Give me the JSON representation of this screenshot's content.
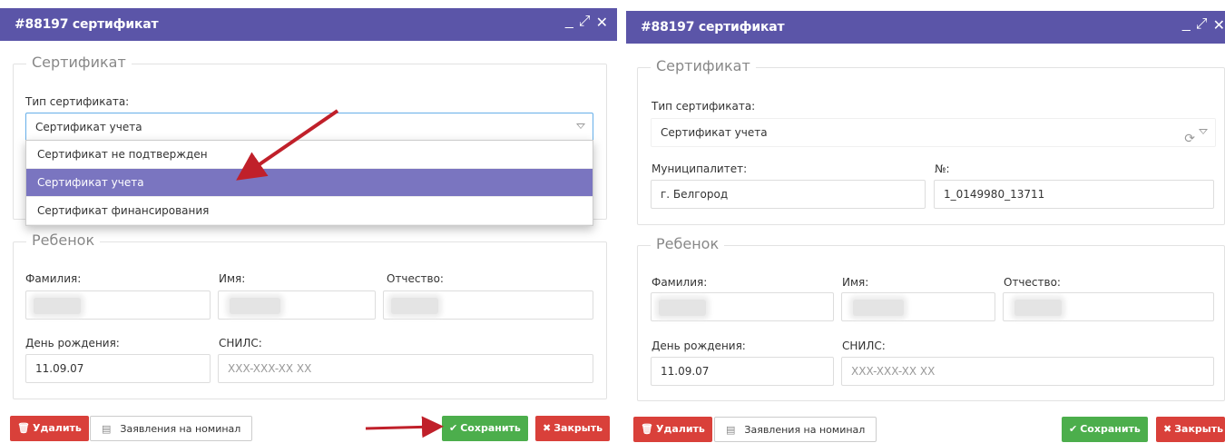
{
  "left": {
    "title": "#88197 сертификат",
    "section_certificate": "Сертификат",
    "cert_type_label": "Тип сертификата:",
    "cert_type_value": "Сертификат учета",
    "dropdown_options": [
      "Сертификат не подтвержден",
      "Сертификат учета",
      "Сертификат финансирования"
    ],
    "section_child": "Ребенок",
    "surname_label": "Фамилия:",
    "name_label": "Имя:",
    "patronymic_label": "Отчество:",
    "birthday_label": "День рождения:",
    "birthday_value": "11.09.07",
    "snils_label": "СНИЛС:",
    "snils_placeholder": "XXX-XXX-XX XX",
    "delete_label": "Удалить",
    "applications_label": "Заявления на номинал",
    "save_label": "Сохранить",
    "close_label": "Закрыть"
  },
  "right": {
    "title": "#88197 сертификат",
    "section_certificate": "Сертификат",
    "cert_type_label": "Тип сертификата:",
    "cert_type_value": "Сертификат учета",
    "municipality_label": "Муниципалитет:",
    "municipality_value": "г. Белгород",
    "number_label": "№:",
    "number_value": "1_0149980_13711",
    "section_child": "Ребенок",
    "surname_label": "Фамилия:",
    "name_label": "Имя:",
    "patronymic_label": "Отчество:",
    "birthday_label": "День рождения:",
    "birthday_value": "11.09.07",
    "snils_label": "СНИЛС:",
    "snils_placeholder": "XXX-XXX-XX XX",
    "delete_label": "Удалить",
    "applications_label": "Заявления на номинал",
    "save_label": "Сохранить",
    "close_label": "Закрыть"
  },
  "window_controls": {
    "minimize": "minimize-icon",
    "maximize": "maximize-icon",
    "close": "close-icon"
  },
  "colors": {
    "titlebar": "#5b55a8",
    "selected_option": "#7a75c0",
    "save": "#4cae4c",
    "danger": "#d9403a",
    "arrow": "#c0202a"
  }
}
